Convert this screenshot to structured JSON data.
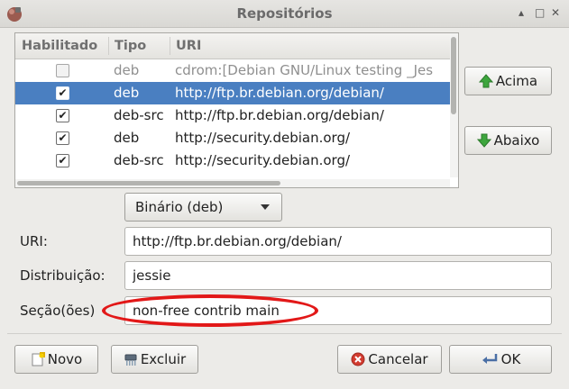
{
  "window": {
    "title": "Repositórios",
    "controls": [
      "▴",
      "□",
      "✕"
    ]
  },
  "table": {
    "headers": [
      "Habilitado",
      "Tipo",
      "URI"
    ],
    "rows": [
      {
        "enabled": false,
        "check": "",
        "type": "deb",
        "uri": "cdrom:[Debian GNU/Linux testing _Jes",
        "state": "disabled"
      },
      {
        "enabled": true,
        "check": "✔",
        "type": "deb",
        "uri": "http://ftp.br.debian.org/debian/",
        "state": "selected"
      },
      {
        "enabled": true,
        "check": "✔",
        "type": "deb-src",
        "uri": "http://ftp.br.debian.org/debian/",
        "state": "normal"
      },
      {
        "enabled": true,
        "check": "✔",
        "type": "deb",
        "uri": "http://security.debian.org/",
        "state": "normal"
      },
      {
        "enabled": true,
        "check": "✔",
        "type": "deb-src",
        "uri": "http://security.debian.org/",
        "state": "normal"
      }
    ]
  },
  "side_buttons": {
    "up_label": "Acima",
    "down_label": "Abaixo"
  },
  "form": {
    "type_select": "Binário (deb)",
    "uri_label": "URI:",
    "uri_value": "http://ftp.br.debian.org/debian/",
    "dist_label": "Distribuição:",
    "dist_value": "jessie",
    "section_label": "Seção(ões)",
    "section_value": "non-free contrib main"
  },
  "footer": {
    "new_label": "Novo",
    "delete_label": "Excluir",
    "cancel_label": "Cancelar",
    "ok_label": "OK"
  },
  "colors": {
    "selection": "#4a7fc1",
    "highlight_oval": "#e21818"
  }
}
